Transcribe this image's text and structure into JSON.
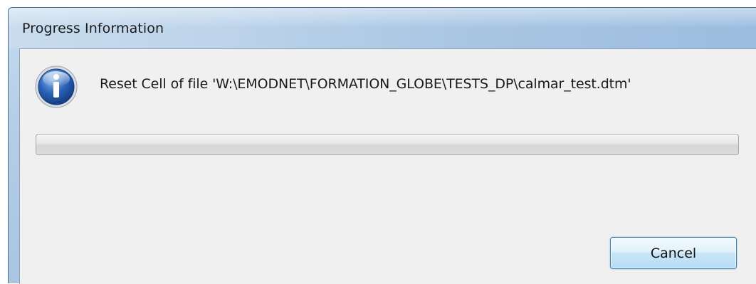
{
  "window": {
    "title": "Progress Information"
  },
  "dialog": {
    "message": "Reset Cell of file 'W:\\EMODNET\\FORMATION_GLOBE\\TESTS_DP\\calmar_test.dtm'",
    "progress": 0,
    "icon": "info-icon"
  },
  "buttons": {
    "cancel_label": "Cancel"
  },
  "colors": {
    "titlebar": "#b5cee7",
    "client_background": "#f0f0f0",
    "button_border": "#3c7fb1",
    "info_icon_blue": "#2456a4"
  }
}
